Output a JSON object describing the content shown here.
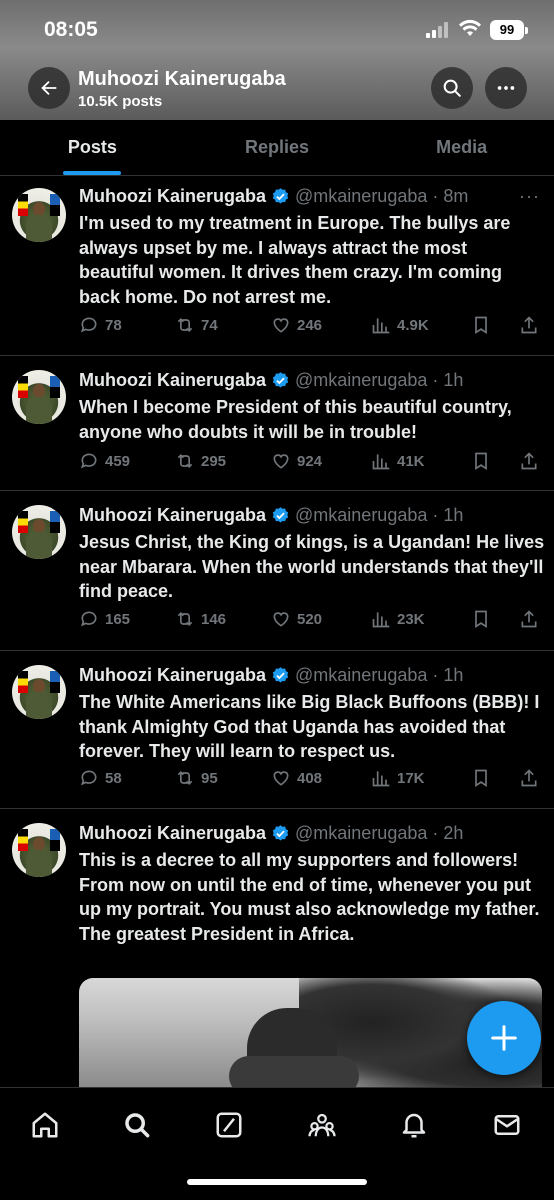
{
  "status_bar": {
    "time": "08:05",
    "battery": "99"
  },
  "header": {
    "name": "Muhoozi Kainerugaba",
    "post_count": "10.5K posts"
  },
  "tabs": [
    {
      "label": "Posts",
      "active": true
    },
    {
      "label": "Replies",
      "active": false
    },
    {
      "label": "Media",
      "active": false
    }
  ],
  "tweets": [
    {
      "name": "Muhoozi Kainerugaba",
      "handle": "@mkainerugaba · 8m",
      "text": "I'm used to my treatment in Europe. The bullys are always upset by me. I always attract the most beautiful women. It drives them crazy.  I'm coming back home. Do not arrest me.",
      "replies": "78",
      "retweets": "74",
      "likes": "246",
      "views": "4.9K"
    },
    {
      "name": "Muhoozi Kainerugaba",
      "handle": "@mkainerugaba · 1h",
      "text": "When I become President of this beautiful country, anyone who doubts it will be in trouble!",
      "replies": "459",
      "retweets": "295",
      "likes": "924",
      "views": "41K"
    },
    {
      "name": "Muhoozi Kainerugaba",
      "handle": "@mkainerugaba · 1h",
      "text": "Jesus Christ, the King of kings,  is a Ugandan! He lives near Mbarara. When the world understands that they'll find peace.",
      "replies": "165",
      "retweets": "146",
      "likes": "520",
      "views": "23K"
    },
    {
      "name": "Muhoozi Kainerugaba",
      "handle": "@mkainerugaba · 1h",
      "text": "The White Americans like Big Black Buffoons (BBB)! I thank Almighty God that Uganda has avoided that forever. They will learn to respect us.",
      "replies": "58",
      "retweets": "95",
      "likes": "408",
      "views": "17K"
    },
    {
      "name": "Muhoozi Kainerugaba",
      "handle": "@mkainerugaba · 2h",
      "text": "This is a decree to all my supporters and followers! From now on until the end of time, whenever you put up my portrait. You must also acknowledge my father. The greatest President in Africa."
    }
  ],
  "icons": {
    "back": "arrow-left-icon",
    "search": "search-icon",
    "more": "more-icon",
    "reply": "reply-icon",
    "retweet": "retweet-icon",
    "like": "heart-icon",
    "views": "views-icon",
    "bookmark": "bookmark-icon",
    "share": "share-icon",
    "compose": "plus-icon"
  },
  "nav": [
    "home-icon",
    "search-icon",
    "grok-icon",
    "communities-icon",
    "notifications-icon",
    "messages-icon"
  ],
  "colors": {
    "accent": "#1d9bf0",
    "muted": "#71767b",
    "background": "#000000",
    "text": "#e7e9ea"
  }
}
